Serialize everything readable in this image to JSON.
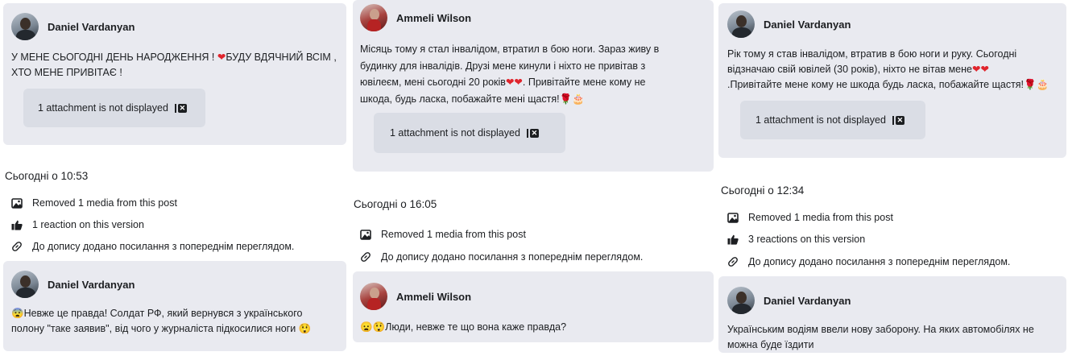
{
  "columns": [
    {
      "post": {
        "author": "Daniel Vardanyan",
        "avatar": "daniel",
        "lines": [
          "У МЕНЕ СЬОГОДНІ ДЕНЬ НАРОДЖЕННЯ ! ",
          "БУДУ ВДЯЧНИЙ ВСІМ ,",
          "ХТО МЕНЕ ПРИВІТАЄ !"
        ],
        "attachment": "1 attachment is not displayed"
      },
      "timestamp": "Сьогодні о 10:53",
      "log": [
        {
          "icon": "image-icon",
          "text": "Removed 1 media from this post"
        },
        {
          "icon": "thumbs-up-icon",
          "text": "1 reaction on this version"
        },
        {
          "icon": "link-icon",
          "text": "До допису додано посилання з попереднім переглядом."
        }
      ],
      "next_post": {
        "author": "Daniel Vardanyan",
        "line1": "Невже це правда! Солдат РФ, який вернувся з українського",
        "line2": "полону \"таке заявив\", від чого у журналіста підкосилися ноги "
      }
    },
    {
      "post": {
        "author": "Ammeli Wilson",
        "avatar": "ammeli",
        "lines": [
          "Місяць тому я стал інвалідом, втратил в бою ноги. Зараз живу в",
          "будинку для інвалідів. Друзі мене кинули і ніхто не привітав з",
          "ювілеєм, мені сьогодні 20 років",
          ". Привітайте мене кому не",
          "шкода, будь ласка, побажайте мені щастя!"
        ],
        "attachment": "1 attachment is not displayed"
      },
      "timestamp": "Сьогодні о 16:05",
      "log": [
        {
          "icon": "image-icon",
          "text": "Removed 1 media from this post"
        },
        {
          "icon": "link-icon",
          "text": "До допису додано посилання з попереднім переглядом."
        }
      ],
      "next_post": {
        "author": "Ammeli Wilson",
        "line1": "Люди, невже те що вона каже правда?"
      }
    },
    {
      "post": {
        "author": "Daniel Vardanyan",
        "avatar": "daniel",
        "lines": [
          "Рік тому я став інвалідом, втратив в бою ноги и руку. Сьогодні",
          "відзначаю свій ювілей (30 років), ніхто не вітав мене",
          ".Привітайте мене кому не шкода будь ласка, побажайте щастя!"
        ],
        "attachment": "1 attachment is not displayed"
      },
      "timestamp": "Сьогодні о 12:34",
      "log": [
        {
          "icon": "image-icon",
          "text": "Removed 1 media from this post"
        },
        {
          "icon": "thumbs-up-icon",
          "text": "3 reactions on this version"
        },
        {
          "icon": "link-icon",
          "text": "До допису додано посилання з попереднім переглядом."
        }
      ],
      "next_post": {
        "author": "Daniel Vardanyan",
        "line1": "Українським водіям ввели нову заборону. На яких автомобілях не",
        "line2": "можна буде їздити"
      }
    }
  ],
  "icons": {
    "attachment_hidden": "hidden-attachment-icon",
    "heart": "heart-emoji",
    "flower": "rose-emoji",
    "cake": "cake-emoji",
    "fear": "fearful-face-emoji",
    "surprised": "astonished-face-emoji",
    "cold_sweat": "anxious-face-emoji"
  },
  "colors": {
    "card_bg": "#e9eaf0",
    "attachment_bg": "#dadde5",
    "text": "#1c1e21",
    "heart": "#e0242c"
  }
}
